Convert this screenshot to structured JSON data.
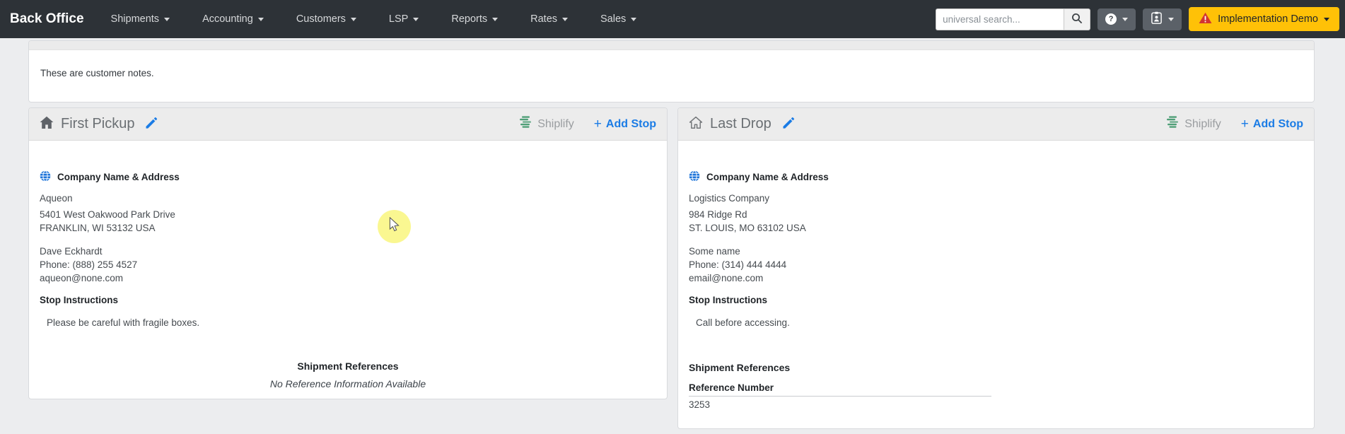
{
  "navbar": {
    "brand": "Back Office",
    "menus": [
      {
        "label": "Shipments"
      },
      {
        "label": "Accounting"
      },
      {
        "label": "Customers"
      },
      {
        "label": "LSP"
      },
      {
        "label": "Reports"
      },
      {
        "label": "Rates"
      },
      {
        "label": "Sales"
      }
    ],
    "search_placeholder": "universal search...",
    "help_glyph": "?",
    "demo_label": "Implementation Demo"
  },
  "notes_card": {
    "text": "These are customer notes."
  },
  "panels": [
    {
      "title": "First Pickup",
      "shiplify": "Shiplify",
      "add_stop_plus": "+",
      "add_stop": "Add Stop",
      "address_heading": "Company Name & Address",
      "company": "Aqueon",
      "address1": "5401 West Oakwood Park Drive",
      "address2": "FRANKLIN, WI 53132 USA",
      "contact": "Dave Eckhardt",
      "phone": "Phone: (888) 255 4527",
      "email": "aqueon@none.com",
      "instructions_heading": "Stop Instructions",
      "instructions": "Please be careful with fragile boxes.",
      "references_heading": "Shipment References",
      "references_empty": "No Reference Information Available"
    },
    {
      "title": "Last Drop",
      "shiplify": "Shiplify",
      "add_stop_plus": "+",
      "add_stop": "Add Stop",
      "address_heading": "Company Name & Address",
      "company": "Logistics Company",
      "address1": "984 Ridge Rd",
      "address2": "ST. LOUIS, MO 63102 USA",
      "contact": "Some name",
      "phone": "Phone: (314) 444 4444",
      "email": "email@none.com",
      "instructions_heading": "Stop Instructions",
      "instructions": "Call before accessing.",
      "references_heading": "Shipment References",
      "reference_column": "Reference Number",
      "reference_value": "3253"
    }
  ],
  "colors": {
    "navbar_bg": "#2d3237",
    "accent_blue": "#1b7ce5",
    "demo_yellow": "#ffc107",
    "warning_red": "#d23430",
    "shiplify_green": "#4f9f77",
    "panel_header_bg": "#ececec"
  }
}
